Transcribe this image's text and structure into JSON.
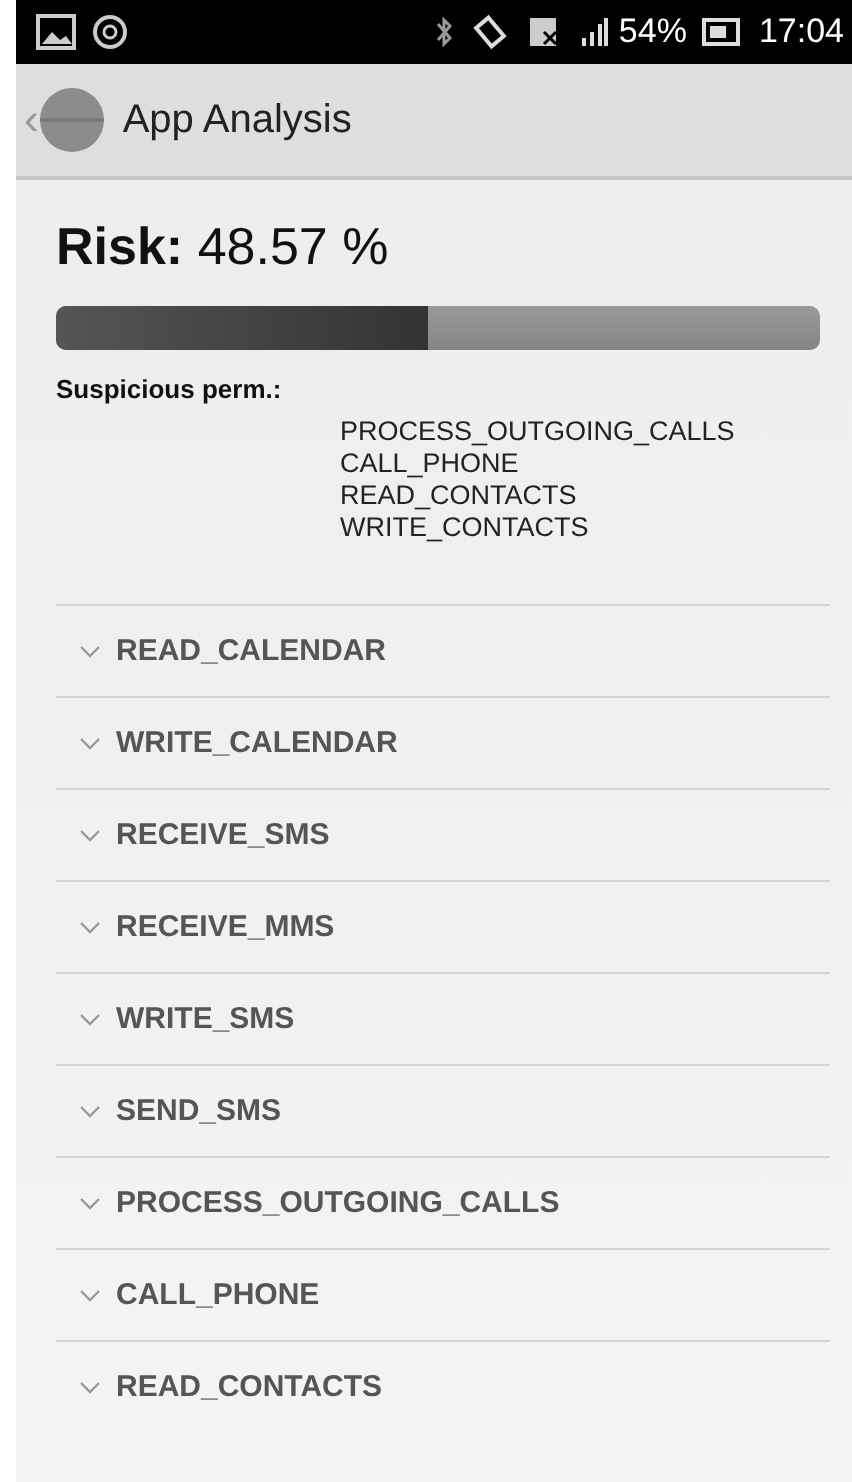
{
  "status_bar": {
    "battery_percent": "54%",
    "time": "17:04"
  },
  "action_bar": {
    "back": "‹",
    "title": "App Analysis"
  },
  "risk": {
    "label": "Risk:",
    "value": "48.57 %",
    "level": 0.4857
  },
  "suspicious": {
    "label": "Suspicious perm.:",
    "permissions": [
      "PROCESS_OUTGOING_CALLS",
      "CALL_PHONE",
      "READ_CONTACTS",
      "WRITE_CONTACTS"
    ]
  },
  "permission_groups": [
    {
      "label": "READ_CALENDAR"
    },
    {
      "label": "WRITE_CALENDAR"
    },
    {
      "label": "RECEIVE_SMS"
    },
    {
      "label": "RECEIVE_MMS"
    },
    {
      "label": "WRITE_SMS"
    },
    {
      "label": "SEND_SMS"
    },
    {
      "label": "PROCESS_OUTGOING_CALLS"
    },
    {
      "label": "CALL_PHONE"
    },
    {
      "label": "READ_CONTACTS"
    }
  ]
}
